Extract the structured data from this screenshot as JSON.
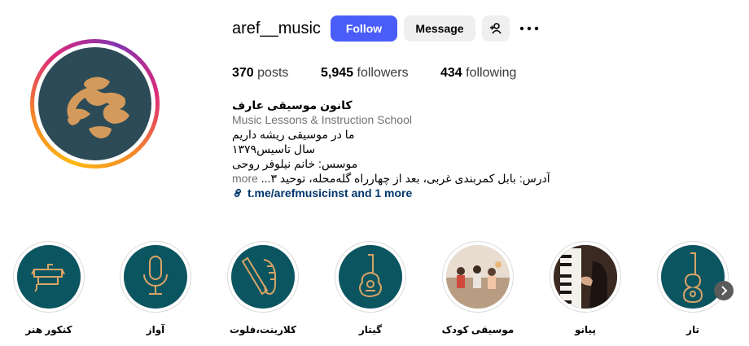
{
  "profile": {
    "username": "aref__music",
    "follow_label": "Follow",
    "message_label": "Message",
    "stats": {
      "posts_count": "370",
      "posts_label": "posts",
      "followers_count": "5,945",
      "followers_label": "followers",
      "following_count": "434",
      "following_label": "following"
    },
    "bio": {
      "name": "کانون موسیقی عارف",
      "category": "Music Lessons & Instruction School",
      "line1": "ما در موسیقی ریشه داریم",
      "line2": "سال تاسیس۱۳۷۹",
      "line3": "موسس: خانم نیلوفر روحی",
      "line4": "آدرس: بابل کمربندی غربی، بعد از چهارراه گله‌محله، توحید ۳...",
      "more_label": "more",
      "link_text": "t.me/arefmusicinst and 1 more"
    }
  },
  "highlights": [
    {
      "label": "کنکور هنر"
    },
    {
      "label": "آواز"
    },
    {
      "label": "کلارینت،فلوت"
    },
    {
      "label": "گیتار"
    },
    {
      "label": "موسیقی کودک"
    },
    {
      "label": "پیانو"
    },
    {
      "label": "تار"
    }
  ],
  "colors": {
    "follow_button": "#4a5df9",
    "avatar_bg": "#2c4b57",
    "logo": "#d49a5b",
    "highlight_bg": "#0b5560",
    "highlight_icon": "#d9a467",
    "link": "#00376b"
  }
}
